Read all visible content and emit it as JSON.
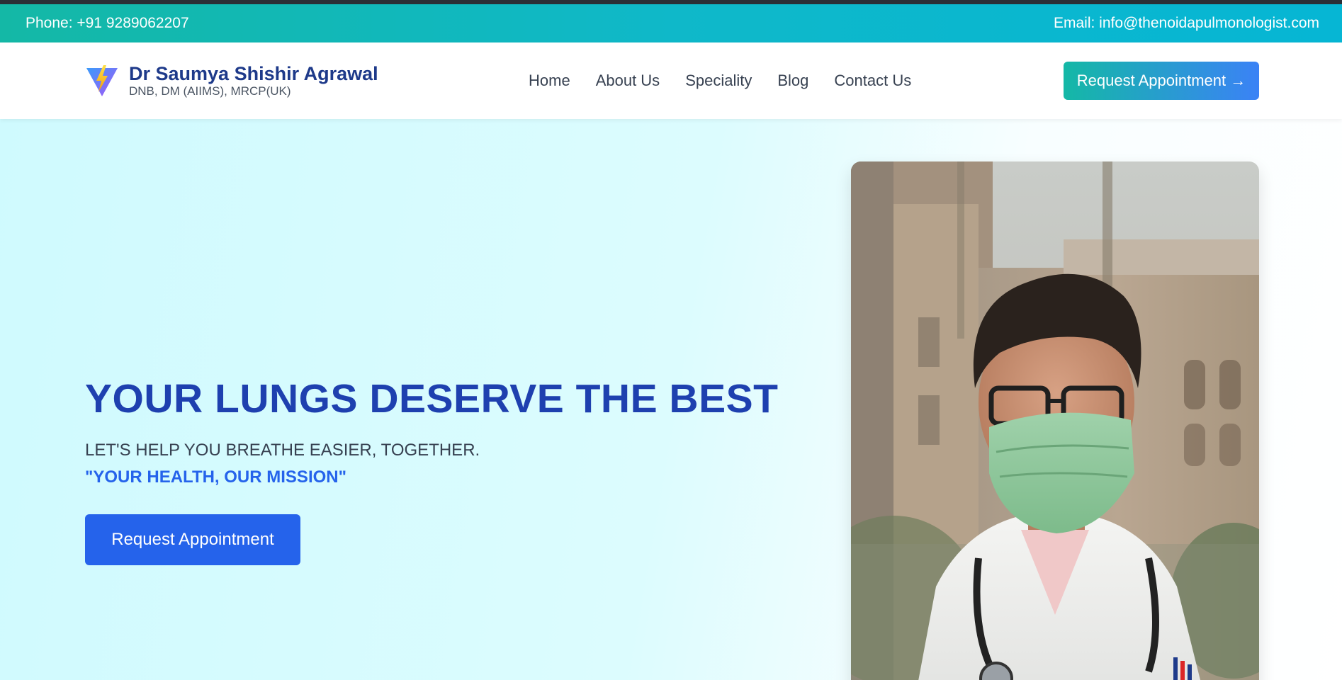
{
  "topbar": {
    "phone": "Phone: +91 9289062207",
    "email": "Email: info@thenoidapulmonologist.com"
  },
  "brand": {
    "name": "Dr Saumya Shishir Agrawal",
    "credentials": "DNB, DM (AIIMS), MRCP(UK)",
    "logo_icon": "lightning-triangle-icon"
  },
  "nav": {
    "items": [
      "Home",
      "About Us",
      "Speciality",
      "Blog",
      "Contact Us"
    ],
    "cta_label": "Request Appointment →"
  },
  "hero": {
    "title": "YOUR LUNGS DESERVE THE BEST",
    "subtitle": "LET'S HELP YOU BREATHE EASIER, TOGETHER.",
    "quote": "\"YOUR HEALTH, OUR MISSION\"",
    "button_label": "Request Appointment",
    "photo_description": "doctor-with-mask-photo"
  },
  "colors": {
    "teal": "#14b8a6",
    "cyan": "#06b6d4",
    "navy": "#1e3a8a",
    "primary_blue": "#2563eb"
  }
}
